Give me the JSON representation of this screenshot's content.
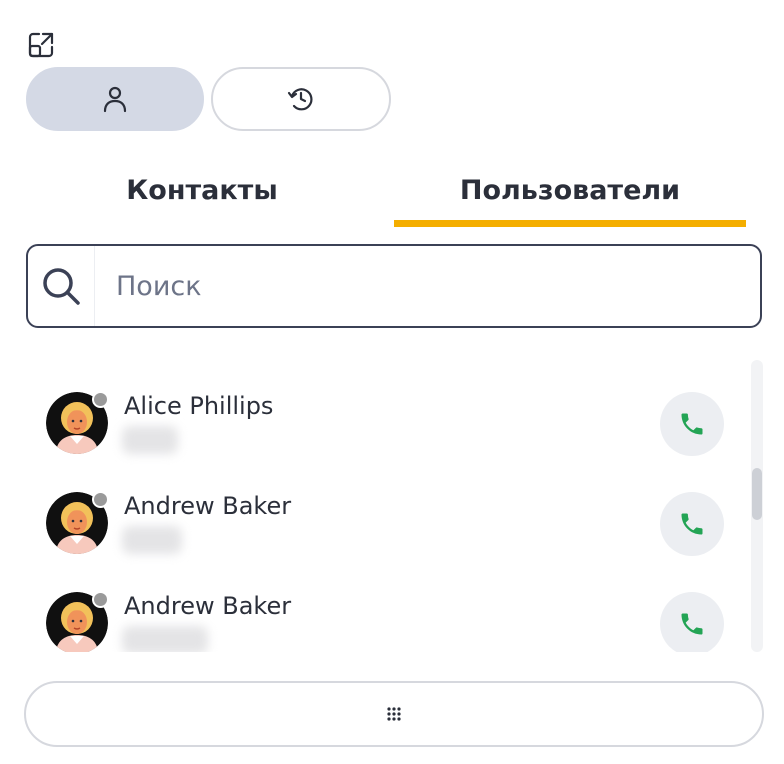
{
  "tabs": {
    "contacts_label": "Контакты",
    "users_label": "Пользователи",
    "active": "users",
    "accent_color": "#f4ae00"
  },
  "search": {
    "placeholder": "Поиск",
    "value": ""
  },
  "users": [
    {
      "name": "Alice Phillips",
      "status": "offline"
    },
    {
      "name": "Andrew Baker",
      "status": "offline"
    },
    {
      "name": "Andrew Baker",
      "status": "offline"
    }
  ],
  "icons": {
    "expand": "expand-icon",
    "contacts_mode": "person-icon",
    "history_mode": "history-icon",
    "search": "search-icon",
    "call": "phone-icon",
    "dialpad": "dialpad-icon"
  },
  "colors": {
    "call_green": "#23a455",
    "status_offline": "#9a9a9a",
    "active_mode_bg": "#d4d9e5"
  }
}
